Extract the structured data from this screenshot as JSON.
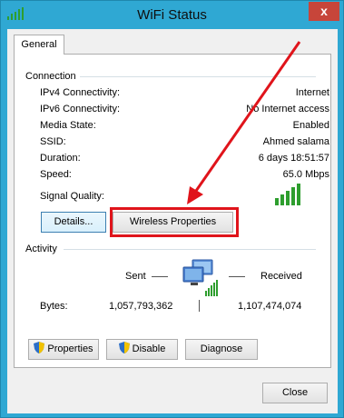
{
  "window": {
    "title": "WiFi Status",
    "close_glyph": "x"
  },
  "tab": {
    "label": "General"
  },
  "connection": {
    "group_label": "Connection",
    "rows": [
      {
        "label": "IPv4 Connectivity:",
        "value": "Internet"
      },
      {
        "label": "IPv6 Connectivity:",
        "value": "No Internet access"
      },
      {
        "label": "Media State:",
        "value": "Enabled"
      },
      {
        "label": "SSID:",
        "value": "Ahmed salama"
      },
      {
        "label": "Duration:",
        "value": "6 days 18:51:57"
      },
      {
        "label": "Speed:",
        "value": "65.0 Mbps"
      }
    ],
    "signal_label": "Signal Quality:",
    "signal_bars": 5,
    "details_button": "Details...",
    "wireless_button": "Wireless Properties"
  },
  "activity": {
    "group_label": "Activity",
    "sent_label": "Sent",
    "received_label": "Received",
    "bytes_label": "Bytes:",
    "bytes_sent": "1,057,793,362",
    "bytes_received": "1,107,474,074"
  },
  "buttons": {
    "properties": "Properties",
    "disable": "Disable",
    "diagnose": "Diagnose",
    "close": "Close"
  },
  "colors": {
    "titlebar": "#2fa8d3",
    "highlight_box": "#e0141b",
    "arrow": "#e0141b",
    "signal_green": "#2e9e2e"
  },
  "icons": {
    "app": "wifi-signal-icon",
    "network": "network-monitor-icon",
    "shield": "uac-shield-icon"
  }
}
